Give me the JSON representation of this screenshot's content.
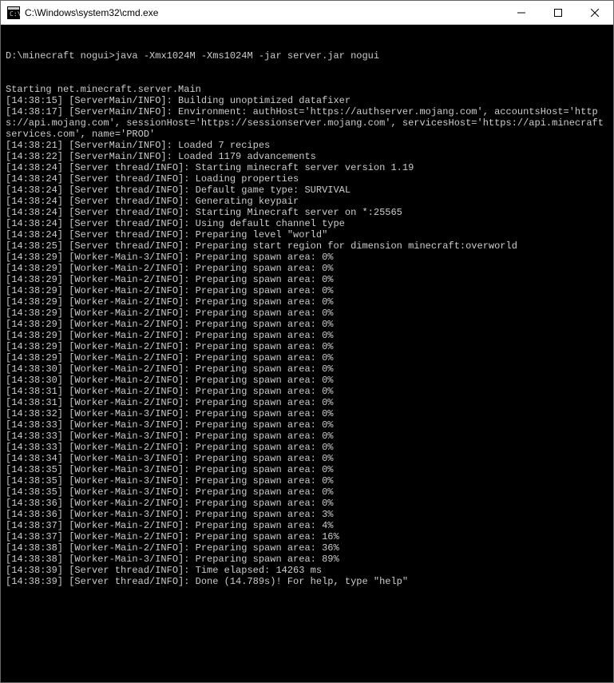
{
  "titlebar": {
    "title": "C:\\Windows\\system32\\cmd.exe"
  },
  "terminal": {
    "prompt": "D:\\minecraft nogui>",
    "command": "java -Xmx1024M -Xms1024M -jar server.jar nogui",
    "lines": [
      "Starting net.minecraft.server.Main",
      "[14:38:15] [ServerMain/INFO]: Building unoptimized datafixer",
      "[14:38:17] [ServerMain/INFO]: Environment: authHost='https://authserver.mojang.com', accountsHost='https://api.mojang.com', sessionHost='https://sessionserver.mojang.com', servicesHost='https://api.minecraftservices.com', name='PROD'",
      "[14:38:21] [ServerMain/INFO]: Loaded 7 recipes",
      "[14:38:22] [ServerMain/INFO]: Loaded 1179 advancements",
      "[14:38:24] [Server thread/INFO]: Starting minecraft server version 1.19",
      "[14:38:24] [Server thread/INFO]: Loading properties",
      "[14:38:24] [Server thread/INFO]: Default game type: SURVIVAL",
      "[14:38:24] [Server thread/INFO]: Generating keypair",
      "[14:38:24] [Server thread/INFO]: Starting Minecraft server on *:25565",
      "[14:38:24] [Server thread/INFO]: Using default channel type",
      "[14:38:24] [Server thread/INFO]: Preparing level \"world\"",
      "[14:38:25] [Server thread/INFO]: Preparing start region for dimension minecraft:overworld",
      "[14:38:29] [Worker-Main-3/INFO]: Preparing spawn area: 0%",
      "[14:38:29] [Worker-Main-2/INFO]: Preparing spawn area: 0%",
      "[14:38:29] [Worker-Main-2/INFO]: Preparing spawn area: 0%",
      "[14:38:29] [Worker-Main-2/INFO]: Preparing spawn area: 0%",
      "[14:38:29] [Worker-Main-2/INFO]: Preparing spawn area: 0%",
      "[14:38:29] [Worker-Main-2/INFO]: Preparing spawn area: 0%",
      "[14:38:29] [Worker-Main-2/INFO]: Preparing spawn area: 0%",
      "[14:38:29] [Worker-Main-2/INFO]: Preparing spawn area: 0%",
      "[14:38:29] [Worker-Main-2/INFO]: Preparing spawn area: 0%",
      "[14:38:29] [Worker-Main-2/INFO]: Preparing spawn area: 0%",
      "[14:38:30] [Worker-Main-2/INFO]: Preparing spawn area: 0%",
      "[14:38:30] [Worker-Main-2/INFO]: Preparing spawn area: 0%",
      "[14:38:31] [Worker-Main-2/INFO]: Preparing spawn area: 0%",
      "[14:38:31] [Worker-Main-2/INFO]: Preparing spawn area: 0%",
      "[14:38:32] [Worker-Main-3/INFO]: Preparing spawn area: 0%",
      "[14:38:33] [Worker-Main-3/INFO]: Preparing spawn area: 0%",
      "[14:38:33] [Worker-Main-3/INFO]: Preparing spawn area: 0%",
      "[14:38:33] [Worker-Main-2/INFO]: Preparing spawn area: 0%",
      "[14:38:34] [Worker-Main-3/INFO]: Preparing spawn area: 0%",
      "[14:38:35] [Worker-Main-3/INFO]: Preparing spawn area: 0%",
      "[14:38:35] [Worker-Main-3/INFO]: Preparing spawn area: 0%",
      "[14:38:35] [Worker-Main-3/INFO]: Preparing spawn area: 0%",
      "[14:38:36] [Worker-Main-2/INFO]: Preparing spawn area: 0%",
      "[14:38:36] [Worker-Main-3/INFO]: Preparing spawn area: 3%",
      "[14:38:37] [Worker-Main-2/INFO]: Preparing spawn area: 4%",
      "[14:38:37] [Worker-Main-2/INFO]: Preparing spawn area: 16%",
      "[14:38:38] [Worker-Main-2/INFO]: Preparing spawn area: 36%",
      "[14:38:38] [Worker-Main-3/INFO]: Preparing spawn area: 89%",
      "[14:38:39] [Server thread/INFO]: Time elapsed: 14263 ms",
      "[14:38:39] [Server thread/INFO]: Done (14.789s)! For help, type \"help\""
    ]
  }
}
